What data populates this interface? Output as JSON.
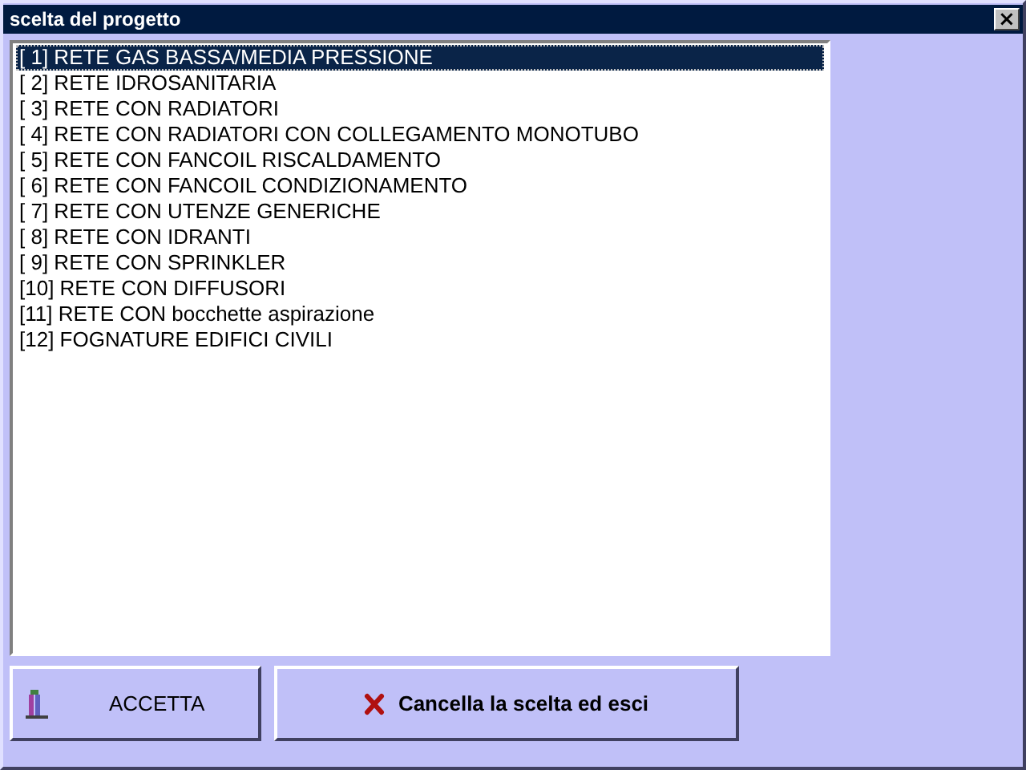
{
  "window": {
    "title": "scelta del progetto",
    "close_label": "×"
  },
  "list": {
    "items": [
      {
        "label": "[ 1] RETE GAS BASSA/MEDIA PRESSIONE",
        "selected": true
      },
      {
        "label": "[ 2] RETE IDROSANITARIA",
        "selected": false
      },
      {
        "label": "[ 3] RETE CON RADIATORI",
        "selected": false
      },
      {
        "label": "[ 4] RETE CON RADIATORI CON COLLEGAMENTO MONOTUBO",
        "selected": false
      },
      {
        "label": "[ 5] RETE CON FANCOIL RISCALDAMENTO",
        "selected": false
      },
      {
        "label": "[ 6] RETE CON FANCOIL CONDIZIONAMENTO",
        "selected": false
      },
      {
        "label": "[ 7] RETE CON UTENZE GENERICHE",
        "selected": false
      },
      {
        "label": "[ 8] RETE CON IDRANTI",
        "selected": false
      },
      {
        "label": "[ 9] RETE CON SPRINKLER",
        "selected": false
      },
      {
        "label": "[10] RETE CON DIFFUSORI",
        "selected": false
      },
      {
        "label": "[11] RETE CON bocchette aspirazione",
        "selected": false
      },
      {
        "label": "[12] FOGNATURE EDIFICI CIVILI",
        "selected": false
      }
    ]
  },
  "buttons": [
    {
      "label": "ACCETTA",
      "kind": "accept"
    },
    {
      "label": "Cancella la scelta ed esci",
      "kind": "cancel"
    }
  ]
}
